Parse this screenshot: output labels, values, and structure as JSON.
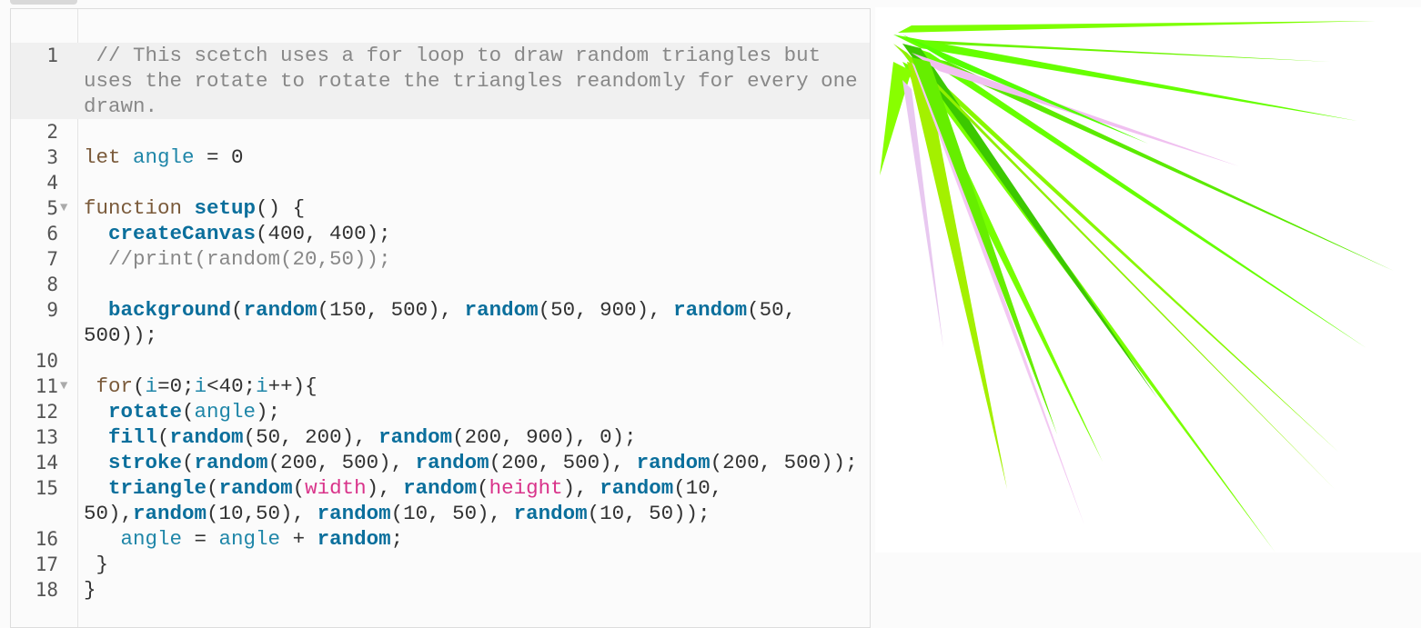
{
  "editor": {
    "lines": [
      {
        "n": "1",
        "hl": true,
        "t": [
          [
            " // This scetch uses a for loop to draw random triangles but uses the rotate to rotate the triangles reandomly for every one drawn.",
            "c"
          ]
        ]
      },
      {
        "n": "2",
        "t": []
      },
      {
        "n": "3",
        "t": [
          [
            "let",
            "k"
          ],
          [
            " ",
            ""
          ],
          [
            "angle",
            "v"
          ],
          [
            " = 0",
            ""
          ]
        ]
      },
      {
        "n": "4",
        "t": []
      },
      {
        "n": "5",
        "fold": true,
        "t": [
          [
            "function",
            "k"
          ],
          [
            " ",
            ""
          ],
          [
            "setup",
            "f"
          ],
          [
            "() {",
            ""
          ]
        ]
      },
      {
        "n": "6",
        "t": [
          [
            "  ",
            ""
          ],
          [
            "createCanvas",
            "f"
          ],
          [
            "(400, 400);",
            ""
          ]
        ]
      },
      {
        "n": "7",
        "t": [
          [
            "  //print(random(20,50));",
            "c"
          ]
        ]
      },
      {
        "n": "8",
        "t": []
      },
      {
        "n": "9",
        "t": [
          [
            "  ",
            ""
          ],
          [
            "background",
            "f"
          ],
          [
            "(",
            ""
          ],
          [
            "random",
            "f"
          ],
          [
            "(150, 500), ",
            ""
          ],
          [
            "random",
            "f"
          ],
          [
            "(50, 900), ",
            ""
          ],
          [
            "random",
            "f"
          ],
          [
            "(50, 500));",
            ""
          ]
        ]
      },
      {
        "n": "10",
        "t": []
      },
      {
        "n": "11",
        "fold": true,
        "t": [
          [
            " for",
            "k"
          ],
          [
            "(",
            ""
          ],
          [
            "i",
            "v"
          ],
          [
            "=0;",
            ""
          ],
          [
            "i",
            "v"
          ],
          [
            "<40;",
            ""
          ],
          [
            "i",
            "v"
          ],
          [
            "++){",
            ""
          ]
        ]
      },
      {
        "n": "12",
        "t": [
          [
            "  ",
            ""
          ],
          [
            "rotate",
            "f"
          ],
          [
            "(",
            ""
          ],
          [
            "angle",
            "v"
          ],
          [
            ");",
            ""
          ]
        ]
      },
      {
        "n": "13",
        "t": [
          [
            "  ",
            ""
          ],
          [
            "fill",
            "f"
          ],
          [
            "(",
            ""
          ],
          [
            "random",
            "f"
          ],
          [
            "(50, 200), ",
            ""
          ],
          [
            "random",
            "f"
          ],
          [
            "(200, 900), 0);",
            ""
          ]
        ]
      },
      {
        "n": "14",
        "t": [
          [
            "  ",
            ""
          ],
          [
            "stroke",
            "f"
          ],
          [
            "(",
            ""
          ],
          [
            "random",
            "f"
          ],
          [
            "(200, 500), ",
            ""
          ],
          [
            "random",
            "f"
          ],
          [
            "(200, 500), ",
            ""
          ],
          [
            "random",
            "f"
          ],
          [
            "(200, 500));",
            ""
          ]
        ]
      },
      {
        "n": "15",
        "t": [
          [
            "  ",
            ""
          ],
          [
            "triangle",
            "f"
          ],
          [
            "(",
            ""
          ],
          [
            "random",
            "f"
          ],
          [
            "(",
            ""
          ],
          [
            "width",
            "p"
          ],
          [
            "), ",
            ""
          ],
          [
            "random",
            "f"
          ],
          [
            "(",
            ""
          ],
          [
            "height",
            "p"
          ],
          [
            "), ",
            ""
          ],
          [
            "random",
            "f"
          ],
          [
            "(10, 50),",
            ""
          ],
          [
            "random",
            "f"
          ],
          [
            "(10,50), ",
            ""
          ],
          [
            "random",
            "f"
          ],
          [
            "(10, 50), ",
            ""
          ],
          [
            "random",
            "f"
          ],
          [
            "(10, 50));",
            ""
          ]
        ]
      },
      {
        "n": "16",
        "t": [
          [
            "   ",
            ""
          ],
          [
            "angle",
            "v"
          ],
          [
            " = ",
            ""
          ],
          [
            "angle",
            "v"
          ],
          [
            " + ",
            ""
          ],
          [
            "random",
            "f"
          ],
          [
            ";",
            ""
          ]
        ]
      },
      {
        "n": "17",
        "t": [
          [
            " }",
            ""
          ]
        ]
      },
      {
        "n": "18",
        "t": [
          [
            "}",
            ""
          ]
        ]
      }
    ]
  }
}
